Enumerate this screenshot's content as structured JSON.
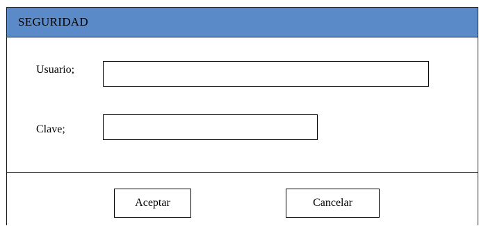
{
  "window": {
    "title": "SEGURIDAD",
    "title_bar_color": "#5b8ac9"
  },
  "form": {
    "usuario_label": "Usuario;",
    "usuario_value": "",
    "clave_label": "Clave;",
    "clave_value": ""
  },
  "buttons": {
    "accept_label": "Aceptar",
    "cancel_label": "Cancelar"
  }
}
